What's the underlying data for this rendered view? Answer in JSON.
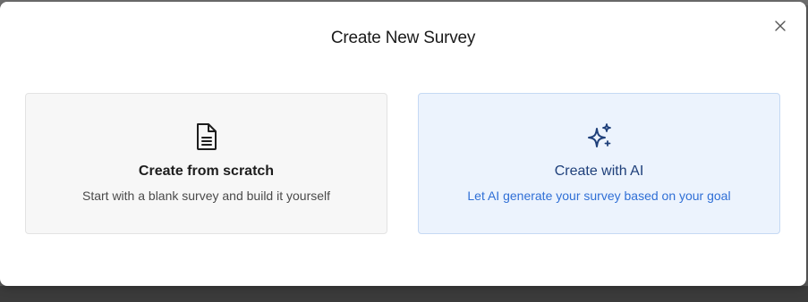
{
  "modal": {
    "title": "Create New Survey",
    "close_icon": "close-icon"
  },
  "options": [
    {
      "icon": "document-icon",
      "title": "Create from scratch",
      "description": "Start with a blank survey and build it yourself"
    },
    {
      "icon": "sparkles-icon",
      "title": "Create with AI",
      "description": "Let AI generate your survey based on your goal"
    }
  ],
  "colors": {
    "ai_card_bg": "#ecf3fd",
    "ai_card_border": "#c5d9f4",
    "ai_title": "#1e3f7a",
    "ai_desc": "#2f6fd6",
    "scratch_card_bg": "#f7f7f7"
  }
}
